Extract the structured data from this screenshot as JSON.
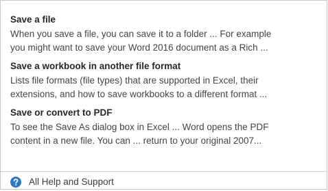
{
  "results": [
    {
      "title": "Save a file",
      "snippet_lines": [
        "When you save a file, you can save it to a folder ... For example",
        "you might want to save your Word 2016 document as a Rich ..."
      ]
    },
    {
      "title": "Save a workbook in another file format",
      "snippet_lines": [
        "Lists file formats (file types) that are supported in Excel, their",
        "extensions, and how to save workbooks to a different format ..."
      ]
    },
    {
      "title": "Save or convert to PDF",
      "snippet_lines": [
        "To see the Save As dialog box in Excel ... Word opens the PDF",
        "content in a new file. You can ... return to your original 2007..."
      ]
    }
  ],
  "footer": {
    "icon": "help-question-icon",
    "label": "All Help and Support"
  },
  "colors": {
    "help_icon_fill": "#2b79c2",
    "border": "#c6c6c6",
    "title_text": "#262626",
    "body_text": "#444444"
  }
}
